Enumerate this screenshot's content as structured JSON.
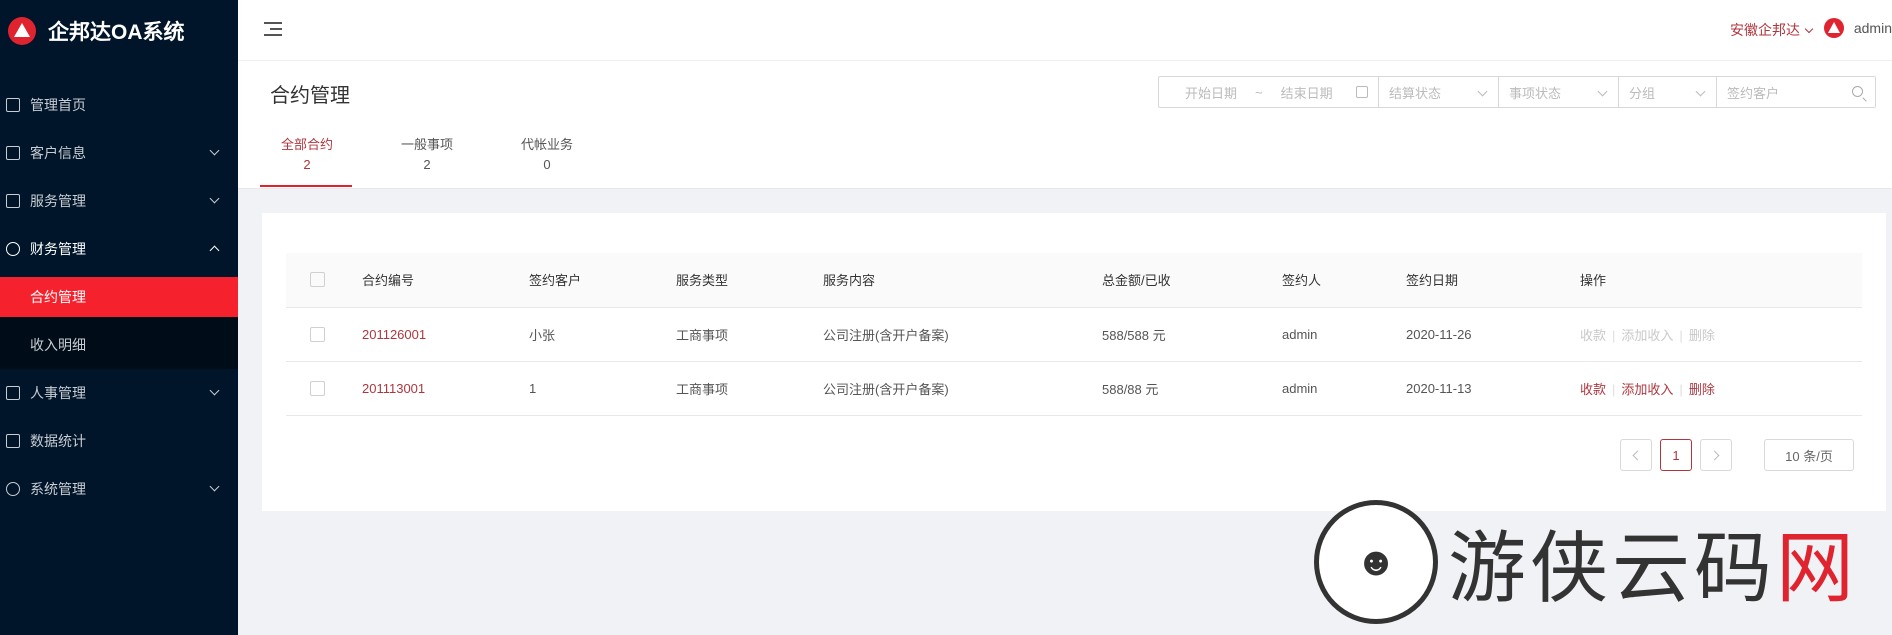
{
  "app": {
    "title": "企邦达OA系统"
  },
  "sidebar": {
    "items": [
      {
        "label": "管理首页",
        "icon": "home-icon"
      },
      {
        "label": "客户信息",
        "icon": "id-card-icon"
      },
      {
        "label": "服务管理",
        "icon": "document-icon"
      },
      {
        "label": "财务管理",
        "icon": "yen-circle-icon"
      },
      {
        "label": "人事管理",
        "icon": "profile-icon"
      },
      {
        "label": "数据统计",
        "icon": "bar-chart-icon"
      },
      {
        "label": "系统管理",
        "icon": "gear-icon"
      }
    ],
    "finance_sub": [
      {
        "label": "合约管理"
      },
      {
        "label": "收入明细"
      }
    ]
  },
  "header": {
    "company": "安徽企邦达",
    "user": "admin"
  },
  "page": {
    "title": "合约管理",
    "filters": {
      "start_date": "开始日期",
      "range_sep": "~",
      "end_date": "结束日期",
      "settle_status": "结算状态",
      "item_status": "事项状态",
      "group": "分组",
      "search_placeholder": "签约客户"
    },
    "tabs": [
      {
        "label": "全部合约",
        "count": "2"
      },
      {
        "label": "一般事项",
        "count": "2"
      },
      {
        "label": "代帐业务",
        "count": "0"
      }
    ]
  },
  "table": {
    "headers": [
      "合约编号",
      "签约客户",
      "服务类型",
      "服务内容",
      "总金额/已收",
      "签约人",
      "签约日期",
      "操作"
    ],
    "rows": [
      {
        "id": "201126001",
        "customer": "小张",
        "type": "工商事项",
        "content": "公司注册(含开户备案)",
        "amount": "588/588 元",
        "signer": "admin",
        "date": "2020-11-26",
        "a1": "收款",
        "a2": "添加收入",
        "a3": "删除"
      },
      {
        "id": "201113001",
        "customer": "1",
        "type": "工商事项",
        "content": "公司注册(含开户备案)",
        "amount": "588/88 元",
        "signer": "admin",
        "date": "2020-11-13",
        "a1": "收款",
        "a2": "添加收入",
        "a3": "删除"
      }
    ]
  },
  "pagination": {
    "current": "1",
    "page_size": "10 条/页"
  },
  "watermark": {
    "text_main": "游侠云码",
    "text_accent": "网"
  },
  "colors": {
    "accent": "#b0363e",
    "sidebar": "#001529",
    "active": "#f5222d"
  }
}
